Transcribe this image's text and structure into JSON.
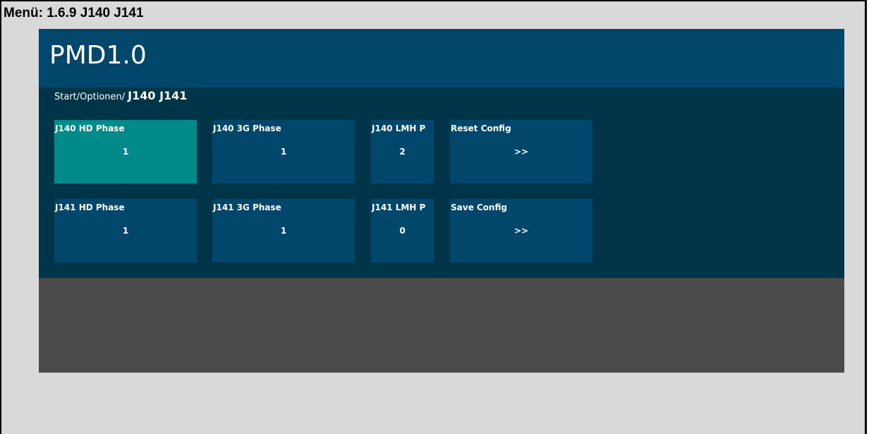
{
  "menu_label": "Menü: 1.6.9 J140 J141",
  "app": {
    "title": "PMD1.0"
  },
  "breadcrumb": {
    "path": "Start/Optionen/",
    "current": "J140 J141"
  },
  "tiles": [
    {
      "label": "J140 HD Phase",
      "value": "1",
      "active": true
    },
    {
      "label": "J140 3G Phase",
      "value": "1"
    },
    {
      "label": "J140 LMH P",
      "value": "2"
    },
    {
      "label": "Reset Config",
      "value": ">>"
    },
    {
      "label": "J141 HD Phase",
      "value": "1"
    },
    {
      "label": "J141 3G Phase",
      "value": "1"
    },
    {
      "label": "J141 LMH P",
      "value": "0"
    },
    {
      "label": "Save Config",
      "value": ">>"
    }
  ],
  "colors": {
    "header": "#00476b",
    "content": "#003549",
    "tile": "#00476b",
    "tile_active": "#008a8a",
    "bottom": "#4a4a4a",
    "frame": "#d9d9d9"
  }
}
